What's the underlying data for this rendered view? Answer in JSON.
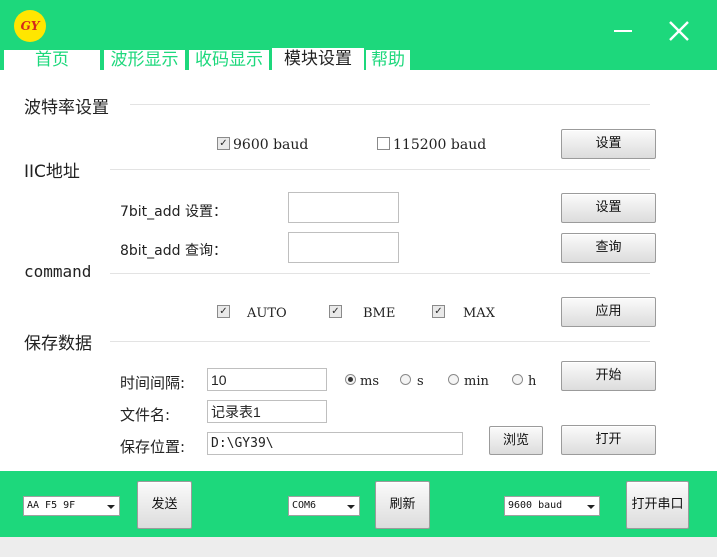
{
  "app": {
    "logo_text": "GY"
  },
  "tabs": [
    {
      "label": "首页"
    },
    {
      "label": "波形显示"
    },
    {
      "label": "收码显示"
    },
    {
      "label": "模块设置"
    },
    {
      "label": "帮助"
    }
  ],
  "active_tab": "模块设置",
  "baud": {
    "title": "波特率设置",
    "opt1": "9600 baud",
    "opt1_checked": true,
    "opt2": "115200 baud",
    "opt2_checked": false,
    "set_button": "设置"
  },
  "iic": {
    "title": "IIC地址",
    "bit7_label": "7bit_add 设置：",
    "bit7_value": "",
    "bit7_button": "设置",
    "bit8_label": "8bit_add 查询：",
    "bit8_value": "",
    "bit8_button": "查询"
  },
  "command": {
    "title": "command",
    "auto": "AUTO",
    "bme": "BME",
    "max": "MAX",
    "auto_checked": true,
    "bme_checked": true,
    "max_checked": true,
    "apply_button": "应用"
  },
  "save": {
    "title": "保存数据",
    "interval_label": "时间间隔:",
    "interval_value": "10",
    "units": [
      "ms",
      "s",
      "min",
      "h"
    ],
    "selected_unit": "ms",
    "start_button": "开始",
    "filename_label": "文件名:",
    "filename_value": "记录表1",
    "location_label": "保存位置:",
    "location_value": "D:\\GY39\\",
    "browse_button": "浏览",
    "open_button": "打开"
  },
  "bottom": {
    "send_combo": "AA F5 9F",
    "send_button": "发送",
    "port_combo": "COM6",
    "refresh_button": "刷新",
    "baud_combo": "9600 baud",
    "open_port_button": "打开串口"
  },
  "colors": {
    "accent": "#1dd87c",
    "logo": "#ffe600"
  }
}
